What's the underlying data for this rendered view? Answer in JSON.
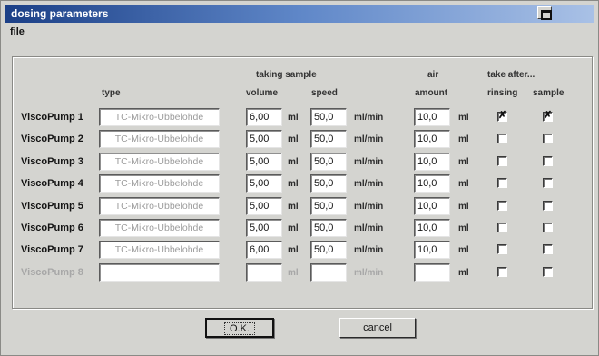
{
  "window": {
    "title": "dosing parameters",
    "icon": "window-restore-icon"
  },
  "menu": {
    "file": "file"
  },
  "headers": {
    "type": "type",
    "taking_sample": "taking sample",
    "volume": "volume",
    "speed": "speed",
    "air": "air",
    "amount": "amount",
    "take_after": "take after...",
    "rinsing": "rinsing",
    "sample": "sample"
  },
  "units": {
    "volume": "ml",
    "speed": "ml/min",
    "air": "ml"
  },
  "pumps": [
    {
      "name": "ViscoPump 1",
      "type": "TC-Mikro-Ubbelohde",
      "volume": "6,00",
      "speed": "50,0",
      "air": "10,0",
      "rinsing": true,
      "sample": true,
      "enabled": true
    },
    {
      "name": "ViscoPump 2",
      "type": "TC-Mikro-Ubbelohde",
      "volume": "5,00",
      "speed": "50,0",
      "air": "10,0",
      "rinsing": false,
      "sample": false,
      "enabled": true
    },
    {
      "name": "ViscoPump 3",
      "type": "TC-Mikro-Ubbelohde",
      "volume": "5,00",
      "speed": "50,0",
      "air": "10,0",
      "rinsing": false,
      "sample": false,
      "enabled": true
    },
    {
      "name": "ViscoPump 4",
      "type": "TC-Mikro-Ubbelohde",
      "volume": "5,00",
      "speed": "50,0",
      "air": "10,0",
      "rinsing": false,
      "sample": false,
      "enabled": true
    },
    {
      "name": "ViscoPump 5",
      "type": "TC-Mikro-Ubbelohde",
      "volume": "5,00",
      "speed": "50,0",
      "air": "10,0",
      "rinsing": false,
      "sample": false,
      "enabled": true
    },
    {
      "name": "ViscoPump 6",
      "type": "TC-Mikro-Ubbelohde",
      "volume": "5,00",
      "speed": "50,0",
      "air": "10,0",
      "rinsing": false,
      "sample": false,
      "enabled": true
    },
    {
      "name": "ViscoPump 7",
      "type": "TC-Mikro-Ubbelohde",
      "volume": "6,00",
      "speed": "50,0",
      "air": "10,0",
      "rinsing": false,
      "sample": false,
      "enabled": true
    },
    {
      "name": "ViscoPump 8",
      "type": "",
      "volume": "",
      "speed": "",
      "air": "",
      "rinsing": false,
      "sample": false,
      "enabled": false
    }
  ],
  "buttons": {
    "ok": "O.K.",
    "cancel": "cancel"
  }
}
